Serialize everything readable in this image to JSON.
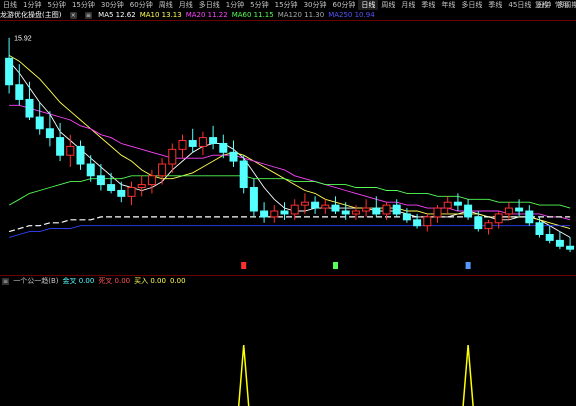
{
  "toolbar": {
    "items": [
      "日线",
      "1分钟",
      "5分钟",
      "15分钟",
      "30分钟",
      "60分钟",
      "周线",
      "月线",
      "多日线",
      "1分钟",
      "5分钟",
      "15分钟",
      "30分钟",
      "60分钟",
      "日线",
      "周线",
      "月线",
      "季线",
      "年线",
      "多日线",
      "季线",
      "45日线",
      "分钟",
      "多周期"
    ],
    "active_index": 14,
    "right_items": [
      "复权",
      "常用"
    ]
  },
  "ma_line": {
    "name": "龙游优化操盘(主图)",
    "items": [
      {
        "label": "MA5 12.62",
        "color": "#ffffff"
      },
      {
        "label": "MA10 13.13",
        "color": "#ffff55"
      },
      {
        "label": "MA20 11.22",
        "color": "#ff44ff"
      },
      {
        "label": "MA60 11.15",
        "color": "#55ff55"
      },
      {
        "label": "MA120 11.30",
        "color": "#aaaaaa"
      },
      {
        "label": "MA250 10.94",
        "color": "#5555ff"
      }
    ]
  },
  "high_label": "15.92",
  "indicator_line": {
    "items": [
      {
        "label": "一个公一趋(B)",
        "color": "#c8c8c8"
      },
      {
        "label": "金叉 0.00",
        "color": "#55ffff"
      },
      {
        "label": "死叉 0.00",
        "color": "#ff5555"
      },
      {
        "label": "买入 0.00",
        "color": "#ffff55"
      },
      {
        "label": "0.00",
        "color": "#ffff55"
      }
    ]
  },
  "colors": {
    "up": "#ff3030",
    "down": "#54ffff",
    "separator": "#6a0000",
    "spike": "#ffff00"
  },
  "chart_data": {
    "type": "candlestick",
    "title": "",
    "candles": [
      [
        15.2,
        15.9,
        14.0,
        14.3
      ],
      [
        14.3,
        15.0,
        13.6,
        13.8
      ],
      [
        13.8,
        14.4,
        13.1,
        13.2
      ],
      [
        13.2,
        13.7,
        12.6,
        12.8
      ],
      [
        12.8,
        13.4,
        12.2,
        12.5
      ],
      [
        12.5,
        13.0,
        11.7,
        11.9
      ],
      [
        11.9,
        12.6,
        11.5,
        12.2
      ],
      [
        12.2,
        12.4,
        11.4,
        11.6
      ],
      [
        11.6,
        11.9,
        11.0,
        11.2
      ],
      [
        11.2,
        11.6,
        10.7,
        10.9
      ],
      [
        10.9,
        11.3,
        10.6,
        10.7
      ],
      [
        10.7,
        11.0,
        10.3,
        10.5
      ],
      [
        10.5,
        11.0,
        10.2,
        10.8
      ],
      [
        10.8,
        11.2,
        10.5,
        10.9
      ],
      [
        10.9,
        11.4,
        10.6,
        11.2
      ],
      [
        11.2,
        11.8,
        10.9,
        11.6
      ],
      [
        11.6,
        12.3,
        11.3,
        12.1
      ],
      [
        12.1,
        12.6,
        11.8,
        12.4
      ],
      [
        12.4,
        12.8,
        12.0,
        12.2
      ],
      [
        12.2,
        12.7,
        11.9,
        12.5
      ],
      [
        12.5,
        12.9,
        12.1,
        12.3
      ],
      [
        12.3,
        12.6,
        11.8,
        12.0
      ],
      [
        12.0,
        12.4,
        11.5,
        11.7
      ],
      [
        11.7,
        11.9,
        10.6,
        10.8
      ],
      [
        10.8,
        11.1,
        9.8,
        10.0
      ],
      [
        10.0,
        10.3,
        9.6,
        9.8
      ],
      [
        9.8,
        10.2,
        9.6,
        10.0
      ],
      [
        10.0,
        10.3,
        9.7,
        9.9
      ],
      [
        9.9,
        10.4,
        9.7,
        10.2
      ],
      [
        10.2,
        10.6,
        9.9,
        10.3
      ],
      [
        10.3,
        10.5,
        9.9,
        10.1
      ],
      [
        10.1,
        10.4,
        9.9,
        10.2
      ],
      [
        10.2,
        10.5,
        9.9,
        10.0
      ],
      [
        10.0,
        10.3,
        9.7,
        9.9
      ],
      [
        9.9,
        10.2,
        9.7,
        10.0
      ],
      [
        10.0,
        10.4,
        9.8,
        10.1
      ],
      [
        10.1,
        10.5,
        9.8,
        9.9
      ],
      [
        9.9,
        10.3,
        9.7,
        10.2
      ],
      [
        10.2,
        10.4,
        9.8,
        9.9
      ],
      [
        9.9,
        10.1,
        9.6,
        9.7
      ],
      [
        9.7,
        9.9,
        9.4,
        9.5
      ],
      [
        9.5,
        9.9,
        9.3,
        9.8
      ],
      [
        9.8,
        10.2,
        9.6,
        10.1
      ],
      [
        10.1,
        10.5,
        9.9,
        10.3
      ],
      [
        10.3,
        10.6,
        10.0,
        10.2
      ],
      [
        10.2,
        10.4,
        9.7,
        9.8
      ],
      [
        9.8,
        10.0,
        9.3,
        9.4
      ],
      [
        9.4,
        9.7,
        9.2,
        9.6
      ],
      [
        9.6,
        10.0,
        9.4,
        9.9
      ],
      [
        9.9,
        10.3,
        9.7,
        10.1
      ],
      [
        10.1,
        10.4,
        9.8,
        10.0
      ],
      [
        10.0,
        10.2,
        9.5,
        9.6
      ],
      [
        9.6,
        9.8,
        9.1,
        9.2
      ],
      [
        9.2,
        9.5,
        8.9,
        9.0
      ],
      [
        9.0,
        9.3,
        8.7,
        8.8
      ],
      [
        8.8,
        9.1,
        8.6,
        8.7
      ]
    ],
    "ma_series": [
      {
        "name": "MA5",
        "color": "#ffffff",
        "values": [
          15.1,
          14.7,
          14.2,
          13.7,
          13.3,
          12.7,
          12.4,
          12.1,
          11.8,
          11.5,
          11.2,
          10.9,
          10.8,
          10.7,
          10.8,
          11.0,
          11.4,
          11.7,
          12.0,
          12.2,
          12.3,
          12.3,
          12.1,
          11.8,
          11.3,
          10.8,
          10.4,
          10.1,
          10.0,
          10.0,
          10.1,
          10.1,
          10.1,
          10.1,
          10.1,
          10.1,
          10.0,
          10.0,
          10.0,
          9.9,
          9.8,
          9.8,
          9.8,
          9.8,
          9.9,
          10.0,
          9.9,
          9.8,
          9.7,
          9.7,
          9.8,
          9.8,
          9.7,
          9.5,
          9.3,
          9.1
        ]
      },
      {
        "name": "MA10",
        "color": "#ffff55",
        "values": [
          15.3,
          15.1,
          14.8,
          14.5,
          14.1,
          13.7,
          13.4,
          13.1,
          12.8,
          12.5,
          12.2,
          11.9,
          11.7,
          11.4,
          11.2,
          11.1,
          11.1,
          11.2,
          11.3,
          11.5,
          11.7,
          11.9,
          12.0,
          11.9,
          11.7,
          11.5,
          11.3,
          11.1,
          10.9,
          10.7,
          10.6,
          10.4,
          10.3,
          10.2,
          10.1,
          10.1,
          10.1,
          10.1,
          10.1,
          10.0,
          10.0,
          9.9,
          9.9,
          9.9,
          9.9,
          9.9,
          9.9,
          9.8,
          9.8,
          9.8,
          9.8,
          9.8,
          9.7,
          9.6,
          9.5,
          9.4
        ]
      },
      {
        "name": "MA20",
        "color": "#ff44ff",
        "values": [
          13.6,
          13.6,
          13.5,
          13.4,
          13.3,
          13.2,
          13.1,
          12.9,
          12.8,
          12.6,
          12.5,
          12.3,
          12.2,
          12.1,
          12.0,
          11.9,
          11.8,
          11.8,
          11.8,
          11.8,
          11.9,
          11.9,
          11.9,
          11.8,
          11.7,
          11.6,
          11.5,
          11.4,
          11.2,
          11.1,
          11.0,
          10.9,
          10.8,
          10.7,
          10.6,
          10.5,
          10.4,
          10.3,
          10.3,
          10.2,
          10.2,
          10.1,
          10.1,
          10.1,
          10.0,
          10.0,
          10.0,
          10.0,
          10.0,
          9.9,
          9.9,
          9.9,
          9.9,
          9.8,
          9.8,
          9.7
        ]
      },
      {
        "name": "MA60",
        "color": "#55ff55",
        "values": [
          10.2,
          10.4,
          10.6,
          10.7,
          10.8,
          10.9,
          11.0,
          11.0,
          11.1,
          11.1,
          11.1,
          11.1,
          11.2,
          11.2,
          11.2,
          11.2,
          11.2,
          11.2,
          11.2,
          11.2,
          11.2,
          11.2,
          11.2,
          11.2,
          11.1,
          11.1,
          11.1,
          11.1,
          11.0,
          11.0,
          11.0,
          10.9,
          10.9,
          10.9,
          10.8,
          10.8,
          10.8,
          10.7,
          10.7,
          10.6,
          10.6,
          10.6,
          10.5,
          10.5,
          10.5,
          10.4,
          10.4,
          10.4,
          10.3,
          10.3,
          10.3,
          10.3,
          10.2,
          10.2,
          10.2,
          10.1
        ]
      },
      {
        "name": "MA250",
        "color": "#3344ff",
        "values": [
          9.1,
          9.2,
          9.3,
          9.3,
          9.4,
          9.4,
          9.4,
          9.5,
          9.5,
          9.5,
          9.5,
          9.5,
          9.5,
          9.5,
          9.5,
          9.5,
          9.5,
          9.5,
          9.5,
          9.5,
          9.5,
          9.5,
          9.5,
          9.5,
          9.5,
          9.5,
          9.5,
          9.5,
          9.5,
          9.5,
          9.5,
          9.5,
          9.5,
          9.5,
          9.5,
          9.5,
          9.5,
          9.5,
          9.5,
          9.5,
          9.5,
          9.5,
          9.5,
          9.5,
          9.5,
          9.5,
          9.5,
          9.5,
          9.5,
          9.5,
          9.5,
          9.5,
          9.5,
          9.5,
          9.5,
          9.5
        ]
      },
      {
        "name": "MA120",
        "color": "#ffffff",
        "dashed": true,
        "values": [
          9.3,
          9.4,
          9.5,
          9.5,
          9.6,
          9.6,
          9.7,
          9.7,
          9.7,
          9.8,
          9.8,
          9.8,
          9.8,
          9.8,
          9.8,
          9.8,
          9.8,
          9.8,
          9.8,
          9.8,
          9.8,
          9.8,
          9.8,
          9.8,
          9.8,
          9.8,
          9.8,
          9.8,
          9.8,
          9.8,
          9.8,
          9.8,
          9.8,
          9.8,
          9.8,
          9.8,
          9.8,
          9.8,
          9.8,
          9.8,
          9.8,
          9.8,
          9.8,
          9.8,
          9.8,
          9.8,
          9.8,
          9.8,
          9.8,
          9.8,
          9.8,
          9.8,
          9.8,
          9.8,
          9.8,
          9.8
        ]
      }
    ],
    "ylim": [
      8.4,
      16.3
    ],
    "markers": [
      {
        "index": 23,
        "color": "#ff3030"
      },
      {
        "index": 32,
        "color": "#55ff55"
      },
      {
        "index": 45,
        "color": "#5599ff"
      }
    ],
    "indicator": {
      "spikes": [
        23,
        45
      ],
      "ylim": [
        0,
        1
      ]
    }
  }
}
